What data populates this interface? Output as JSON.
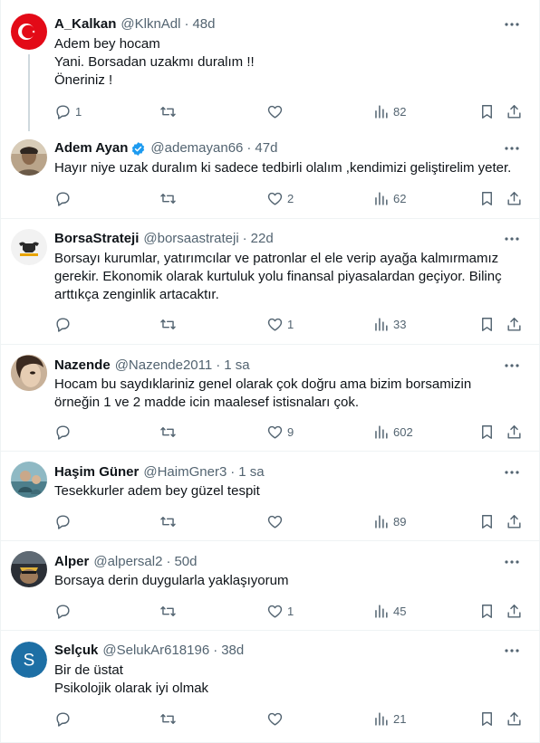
{
  "tweets": [
    {
      "name": "A_Kalkan",
      "handle": "@KlknAdl",
      "time": "48d",
      "lines": [
        "Adem bey hocam",
        "Yani.  Borsadan uzakmı duralım !!",
        "Öneriniz !"
      ],
      "replies": "1",
      "retweets": "",
      "likes": "",
      "views": "82",
      "avatar": "turkish-flag",
      "verified": false
    },
    {
      "name": "Adem Ayan",
      "handle": "@ademayan66",
      "time": "47d",
      "lines": [
        "Hayır niye uzak duralım ki sadece tedbirli olalım ,kendimizi geliştirelim yeter."
      ],
      "replies": "",
      "retweets": "",
      "likes": "2",
      "views": "62",
      "avatar": "photo",
      "verified": true
    },
    {
      "name": "BorsaStrateji",
      "handle": "@borsaastrateji",
      "time": "22d",
      "lines": [
        "Borsayı kurumlar, yatırımcılar ve patronlar el ele verip ayağa kalmırmamız",
        "gerekir. Ekonomik olarak kurtuluk yolu finansal piyasalardan geçiyor. Bilinç",
        "arttıkça zenginlik artacaktır."
      ],
      "replies": "",
      "retweets": "",
      "likes": "1",
      "views": "33",
      "avatar": "bull-logo",
      "verified": false
    },
    {
      "name": "Nazende",
      "handle": "@Nazende2011",
      "time": "1 sa",
      "lines": [
        "Hocam bu saydıklariniz genel olarak çok doğru ama bizim borsamizin",
        "örneğin 1 ve 2 madde icin maalesef istisnaları çok."
      ],
      "replies": "",
      "retweets": "",
      "likes": "9",
      "views": "602",
      "avatar": "photo",
      "verified": false
    },
    {
      "name": "Haşim Güner",
      "handle": "@HaimGner3",
      "time": "1 sa",
      "lines": [
        "Tesekkurler adem bey güzel tespit"
      ],
      "replies": "",
      "retweets": "",
      "likes": "",
      "views": "89",
      "avatar": "photo",
      "verified": false
    },
    {
      "name": "Alper",
      "handle": "@alpersal2",
      "time": "50d",
      "lines": [
        "Borsaya derin duygularla yaklaşıyorum"
      ],
      "replies": "",
      "retweets": "",
      "likes": "1",
      "views": "45",
      "avatar": "photo",
      "verified": false
    },
    {
      "name": "Selçuk",
      "handle": "@SelukAr618196",
      "time": "38d",
      "lines": [
        "Bir de üstat",
        "Psikolojik olarak iyi olmak"
      ],
      "replies": "",
      "retweets": "",
      "likes": "",
      "views": "21",
      "avatar": "letter-avatar",
      "avatar_letter": "S",
      "verified": false
    }
  ],
  "colors": {
    "text": "#0f1419",
    "secondary": "#536471",
    "verified_blue": "#1d9bf0",
    "border": "#eff3f4",
    "letter_avatar_bg": "#1d6fa5"
  }
}
